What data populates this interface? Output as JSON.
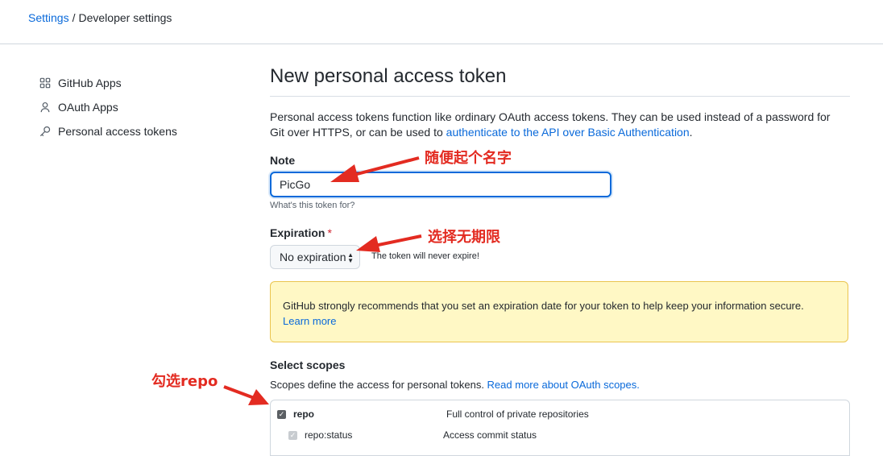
{
  "breadcrumb": {
    "settings": "Settings",
    "separator": "/",
    "current": "Developer settings"
  },
  "sidebar": {
    "items": [
      {
        "label": "GitHub Apps",
        "icon": "apps-icon"
      },
      {
        "label": "OAuth Apps",
        "icon": "person-icon"
      },
      {
        "label": "Personal access tokens",
        "icon": "key-icon"
      }
    ]
  },
  "main": {
    "title": "New personal access token",
    "description_prefix": "Personal access tokens function like ordinary OAuth access tokens. They can be used instead of a password for Git over HTTPS, or can be used to ",
    "description_link": "authenticate to the API over Basic Authentication",
    "description_suffix": "."
  },
  "note": {
    "label": "Note",
    "value": "PicGo",
    "hint": "What's this token for?"
  },
  "expiration": {
    "label": "Expiration",
    "required_mark": "*",
    "selected": "No expiration",
    "note": "The token will never expire!"
  },
  "flash": {
    "message": "GitHub strongly recommends that you set an expiration date for your token to help keep your information secure.",
    "link": "Learn more"
  },
  "scopes": {
    "label": "Select scopes",
    "desc_prefix": "Scopes define the access for personal tokens. ",
    "desc_link": "Read more about OAuth scopes.",
    "rows": [
      {
        "name": "repo",
        "description": "Full control of private repositories",
        "checked": true
      },
      {
        "name": "repo:status",
        "description": "Access commit status",
        "checked": true
      }
    ]
  },
  "annotations": {
    "note": "随便起个名字",
    "expiration": "选择无期限",
    "repo": "勾选repo",
    "color": "#e32b21"
  },
  "colors": {
    "link": "#0969da",
    "flash_bg": "#fff8c5",
    "flash_border": "#eac54f",
    "focus": "#0969da"
  }
}
